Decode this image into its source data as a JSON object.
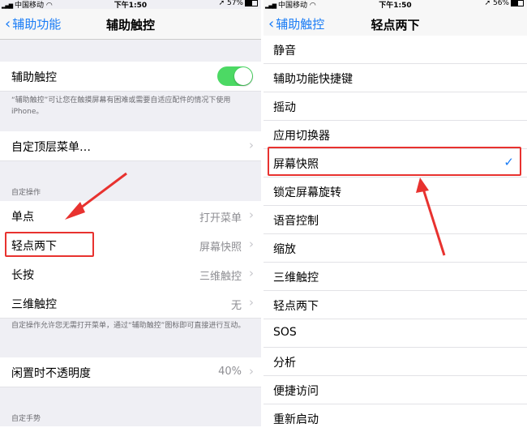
{
  "left": {
    "status": {
      "carrier": "中国移动",
      "time": "下午1:50",
      "battery": "57%",
      "battery_level": 0.57
    },
    "nav": {
      "back": "辅助功能",
      "title": "辅助触控"
    },
    "assistive_touch": {
      "label": "辅助触控",
      "on": true
    },
    "assistive_touch_footer": "“辅助触控”可让您在触摸屏幕有困难或需要自适应配件的情况下使用 iPhone。",
    "customize_top_menu": "自定顶层菜单…",
    "custom_actions_header": "自定操作",
    "actions": [
      {
        "label": "单点",
        "value": "打开菜单"
      },
      {
        "label": "轻点两下",
        "value": "屏幕快照"
      },
      {
        "label": "长按",
        "value": "三维触控"
      },
      {
        "label": "三维触控",
        "value": "无"
      }
    ],
    "actions_footer": "自定操作允许您无需打开菜单，通过“辅助触控”图标即可直接进行互动。",
    "idle_opacity": {
      "label": "闲置时不透明度",
      "value": "40%"
    },
    "custom_gestures_header": "自定手势"
  },
  "right": {
    "status": {
      "carrier": "中国移动",
      "time": "下午1:50",
      "battery": "56%",
      "battery_level": 0.56
    },
    "nav": {
      "back": "辅助触控",
      "title": "轻点两下"
    },
    "options": [
      "静音",
      "辅助功能快捷键",
      "摇动",
      "应用切换器",
      "屏幕快照",
      "锁定屏幕旋转",
      "语音控制",
      "缩放",
      "三维触控",
      "轻点两下",
      "SOS",
      "分析",
      "便捷访问",
      "重新启动"
    ],
    "selected": "屏幕快照"
  },
  "colors": {
    "accent": "#1a7cf6",
    "highlight": "#e8322f",
    "toggle_on": "#4cd964"
  }
}
